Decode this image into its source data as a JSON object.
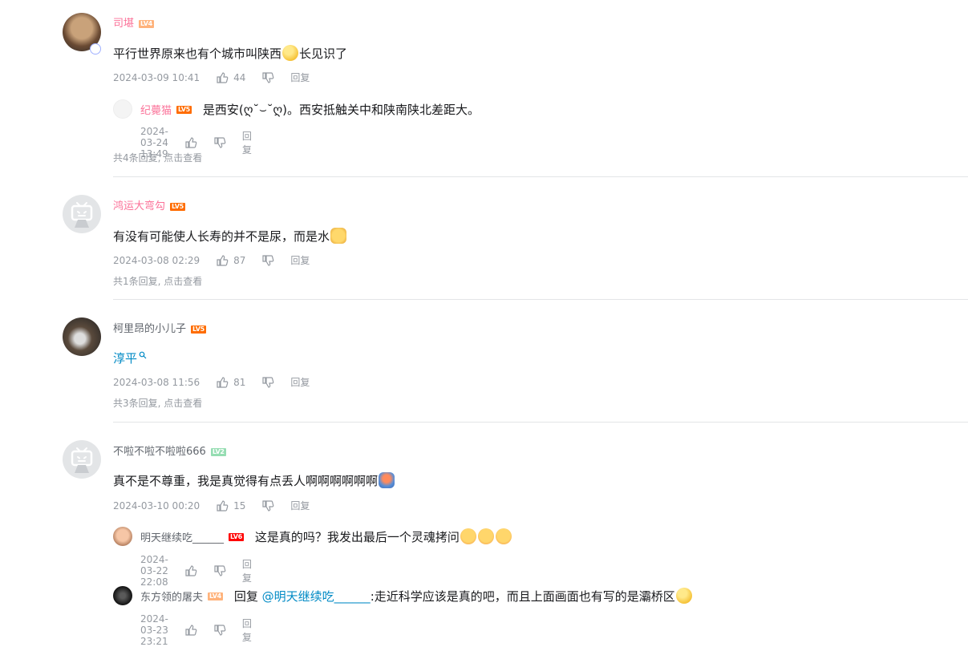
{
  "comments": [
    {
      "username": "司堪",
      "level": "LV4",
      "text_before": "平行世界原来也有个城市叫陕西",
      "text_after": "长见识了",
      "time": "2024-03-09 10:41",
      "likes": "44",
      "reply_label": "回复",
      "replies": [
        {
          "username": "纪薨猫",
          "level": "LV5",
          "text": "是西安(ღ˘⌣˘ღ)。西安抵触关中和陕南陕北差距大。",
          "time": "2024-03-24 13:49",
          "reply_label": "回复"
        }
      ],
      "view_more": "共4条回复, 点击查看"
    },
    {
      "username": "鸿运大弯勾",
      "level": "LV5",
      "text_before": "有没有可能使人长寿的并不是尿，而是水",
      "time": "2024-03-08 02:29",
      "likes": "87",
      "reply_label": "回复",
      "view_more": "共1条回复, 点击查看"
    },
    {
      "username": "柯里昂的小儿子",
      "level": "LV5",
      "text_link": "淳平",
      "time": "2024-03-08 11:56",
      "likes": "81",
      "reply_label": "回复",
      "view_more": "共3条回复, 点击查看"
    },
    {
      "username": "不啦不啦不啦啦666",
      "level": "LV2",
      "text_before": "真不是不尊重，我是真觉得有点丢人啊啊啊啊啊啊",
      "time": "2024-03-10 00:20",
      "likes": "15",
      "reply_label": "回复",
      "replies": [
        {
          "username": "明天继续吃______",
          "level": "LV6",
          "text": "这是真的吗？我发出最后一个灵魂拷问",
          "time": "2024-03-22 22:08",
          "reply_label": "回复"
        },
        {
          "username": "东方领的屠夫",
          "level": "LV4",
          "text_prefix": "回复",
          "mention": "@明天继续吃______",
          "text": ":走近科学应该是真的吧，而且上面画面也有写的是灞桥区",
          "time": "2024-03-23 23:21",
          "reply_label": "回复"
        }
      ]
    }
  ],
  "colors": {
    "pink_name": "#fb7299",
    "link": "#008ac5",
    "meta": "#9499a0"
  },
  "icons": [
    "like-icon",
    "dislike-icon",
    "search-icon",
    "bilibili-tv-icon"
  ]
}
